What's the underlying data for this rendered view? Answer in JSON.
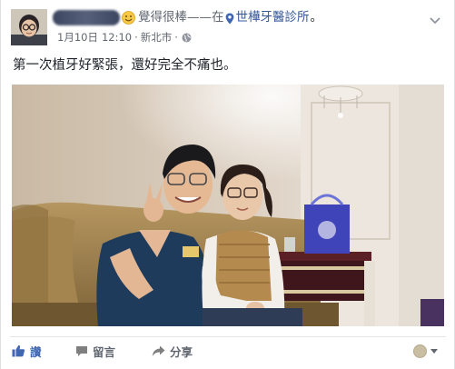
{
  "post": {
    "feeling_text": "覺得很棒——在",
    "place_name": "世樺牙醫診所",
    "place_suffix": "。",
    "date": "1月10日",
    "time": "12:10",
    "dot": "·",
    "location": "新北市",
    "message": "第一次植牙好緊張，還好完全不痛也。"
  },
  "actions": {
    "like": "讚",
    "comment": "留言",
    "share": "分享"
  },
  "icons": {
    "feeling": "smiley-emoji-icon",
    "place": "location-pin-icon",
    "privacy": "globe-icon",
    "menu": "chevron-down-icon",
    "like": "thumbs-up-icon",
    "comment": "speech-bubble-icon",
    "share": "share-arrow-icon"
  },
  "colors": {
    "link": "#365899",
    "like_active": "#4267b2",
    "meta": "#616770"
  }
}
